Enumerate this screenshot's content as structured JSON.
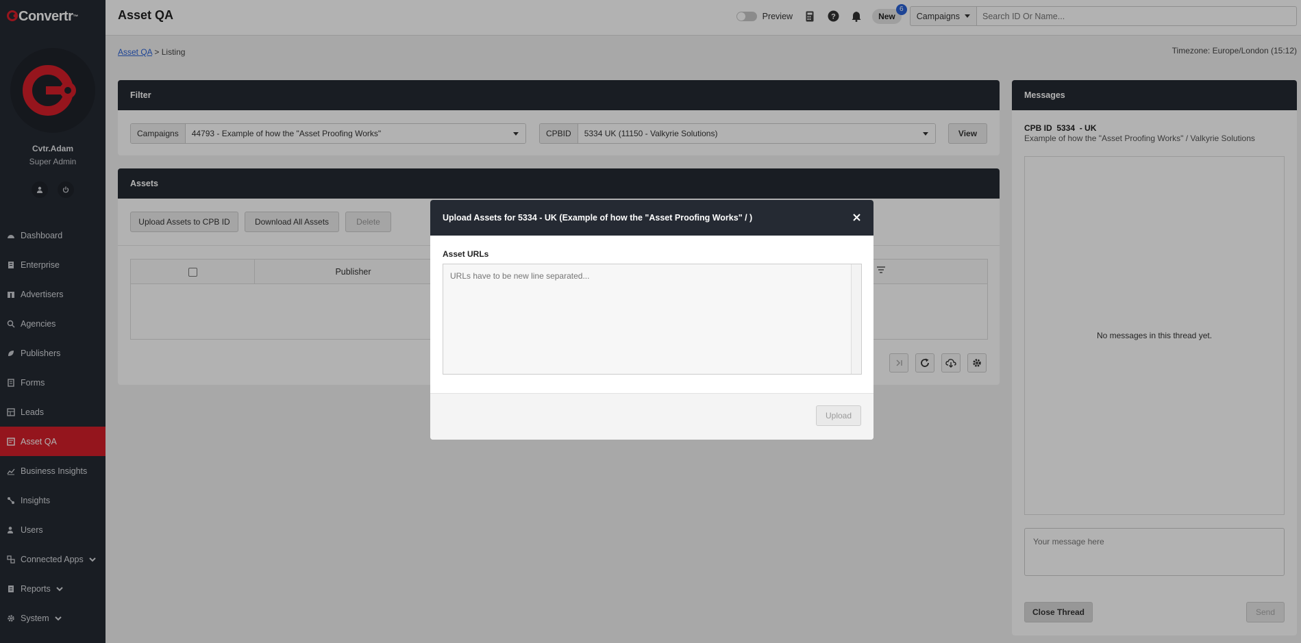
{
  "brand": {
    "name": "Convertr",
    "mark": "C",
    "tm": "™"
  },
  "user": {
    "name": "Cvtr.Adam",
    "role": "Super Admin"
  },
  "nav": [
    {
      "label": "Dashboard",
      "icon": "dashboard-icon"
    },
    {
      "label": "Enterprise",
      "icon": "enterprise-icon"
    },
    {
      "label": "Advertisers",
      "icon": "advertisers-icon"
    },
    {
      "label": "Agencies",
      "icon": "agencies-icon"
    },
    {
      "label": "Publishers",
      "icon": "publishers-icon"
    },
    {
      "label": "Forms",
      "icon": "forms-icon"
    },
    {
      "label": "Leads",
      "icon": "leads-icon"
    },
    {
      "label": "Asset QA",
      "icon": "asset-qa-icon",
      "active": true
    },
    {
      "label": "Business Insights",
      "icon": "chart-icon"
    },
    {
      "label": "Insights",
      "icon": "insights-icon"
    },
    {
      "label": "Users",
      "icon": "users-icon"
    },
    {
      "label": "Connected Apps",
      "icon": "apps-icon",
      "expandable": true
    },
    {
      "label": "Reports",
      "icon": "reports-icon",
      "expandable": true
    },
    {
      "label": "System",
      "icon": "gear-icon",
      "expandable": true
    }
  ],
  "topbar": {
    "title": "Asset QA",
    "preview_label": "Preview",
    "new_label": "New",
    "new_count": "6",
    "campaigns_dropdown": "Campaigns",
    "search_placeholder": "Search ID Or Name..."
  },
  "breadcrumb": {
    "link": "Asset QA",
    "separator": ">",
    "current": "Listing"
  },
  "timezone": "Timezone: Europe/London (15:12)",
  "filter": {
    "heading": "Filter",
    "campaigns_label": "Campaigns",
    "campaigns_value": "44793 - Example of how the \"Asset Proofing Works\"",
    "cpbid_label": "CPBID",
    "cpbid_value": "5334 UK (11150 - Valkyrie Solutions)",
    "view_label": "View"
  },
  "assets": {
    "heading": "Assets",
    "upload_label": "Upload Assets to CPB ID",
    "download_label": "Download All Assets",
    "delete_label": "Delete",
    "column_publisher": "Publisher"
  },
  "messages": {
    "heading": "Messages",
    "cpb_title": "CPB ID  5334  - UK",
    "subtitle": "Example of how the \"Asset Proofing Works\" / Valkyrie Solutions",
    "empty_text": "No messages in this thread yet.",
    "input_placeholder": "Your message here",
    "close_thread_label": "Close Thread",
    "send_label": "Send"
  },
  "modal": {
    "title": "Upload Assets for 5334 - UK (Example of how the \"Asset Proofing Works\" / )",
    "field_label": "Asset URLs",
    "placeholder": "URLs have to be new line separated...",
    "upload_label": "Upload"
  },
  "colors": {
    "dark": "#252a33",
    "accent": "#d41f2a",
    "badge": "#2a62d6"
  }
}
